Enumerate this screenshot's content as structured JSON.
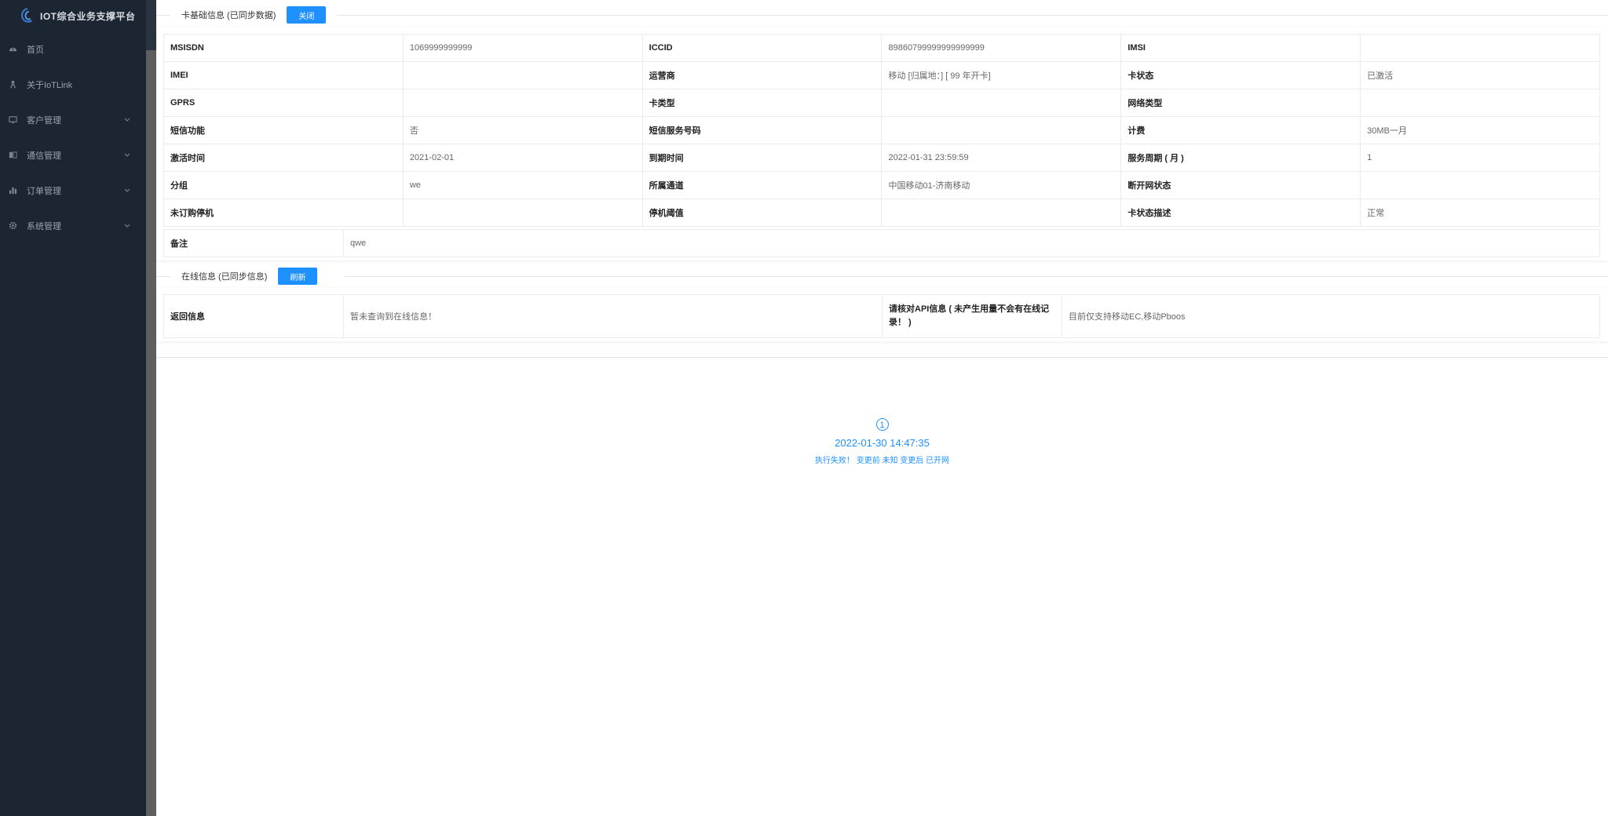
{
  "app": {
    "title": "IOT综合业务支撑平台"
  },
  "sidebar": {
    "items": [
      {
        "label": "首页",
        "icon": "dashboard-icon"
      },
      {
        "label": "关于IoTLink",
        "icon": "person-icon"
      },
      {
        "label": "客户管理",
        "icon": "monitor-icon"
      },
      {
        "label": "通信管理",
        "icon": "book-icon"
      },
      {
        "label": "订单管理",
        "icon": "bar-chart-icon"
      },
      {
        "label": "系统管理",
        "icon": "gear-icon"
      }
    ]
  },
  "card_info": {
    "title": "卡基础信息 (已同步数据)",
    "button": "关闭",
    "rows": [
      [
        "MSISDN",
        "1069999999999",
        "ICCID",
        "89860799999999999999",
        "IMSI",
        ""
      ],
      [
        "IMEI",
        "",
        "运营商",
        "移动 [归属地：] [ 99 年开卡]",
        "卡状态",
        "已激活"
      ],
      [
        "GPRS",
        "",
        "卡类型",
        "",
        "网络类型",
        ""
      ],
      [
        "短信功能",
        "否",
        "短信服务号码",
        "",
        "计费",
        "30MB一月"
      ],
      [
        "激活时间",
        "2021-02-01",
        "到期时间",
        "2022-01-31 23:59:59",
        "服务周期 ( 月 )",
        "1"
      ],
      [
        "分组",
        "we",
        "所属通道",
        "中国移动01-济南移动",
        "断开网状态",
        ""
      ],
      [
        "未订购停机",
        "",
        "停机阈值",
        "",
        "卡状态描述",
        "正常"
      ]
    ],
    "remark_label": "备注",
    "remark_value": "qwe"
  },
  "online_info": {
    "title": "在线信息 (已同步信息)",
    "button": "刷新",
    "return_label": "返回信息",
    "return_value": "暂未查询到在线信息！",
    "api_label": "请核对API信息 ( 未产生用量不会有在线记录！ )",
    "api_value": "目前仅支持移动EC,移动Pboos"
  },
  "timeline": {
    "index": "1",
    "time": "2022-01-30 14:47:35",
    "desc": "执行失败！ 变更前 未知 变更后 已开网"
  },
  "colors": {
    "primary": "#1e90ff",
    "sidebar_bg": "#1c2632"
  }
}
